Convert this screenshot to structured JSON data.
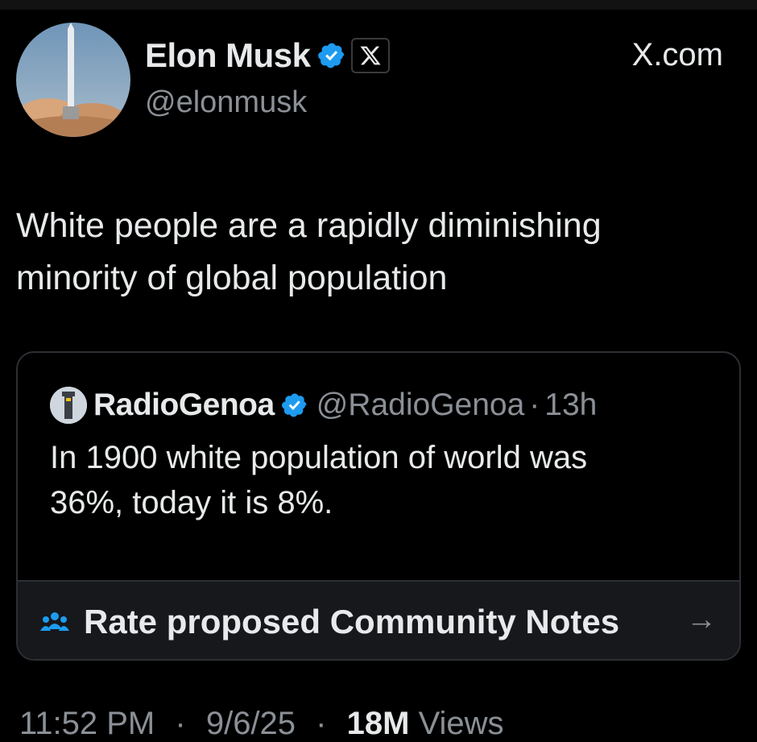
{
  "post": {
    "author": {
      "display_name": "Elon Musk",
      "handle": "@elonmusk",
      "verified_icon": "verified-badge-icon",
      "affiliation_icon": "x-logo-icon"
    },
    "brand": "X.com",
    "text_line_1": "White people are a rapidly diminishing",
    "text_line_2": "minority of global population"
  },
  "quote": {
    "author": {
      "display_name": "RadioGenoa",
      "handle": "@RadioGenoa",
      "separator": "·",
      "time": "13h"
    },
    "text_line_1": "In 1900 white population of world was",
    "text_line_2": "36%, today it is 8%."
  },
  "community_notes": {
    "label": "Rate proposed Community Notes",
    "arrow": "→",
    "icon": "people-icon"
  },
  "meta": {
    "time": "11:52 PM",
    "date": "9/6/25",
    "views_count": "18M",
    "views_label": "Views"
  },
  "colors": {
    "background": "#000000",
    "text": "#e7e9ea",
    "muted": "#8b9096",
    "verified": "#1d9bf0",
    "border": "#2c2f33"
  }
}
